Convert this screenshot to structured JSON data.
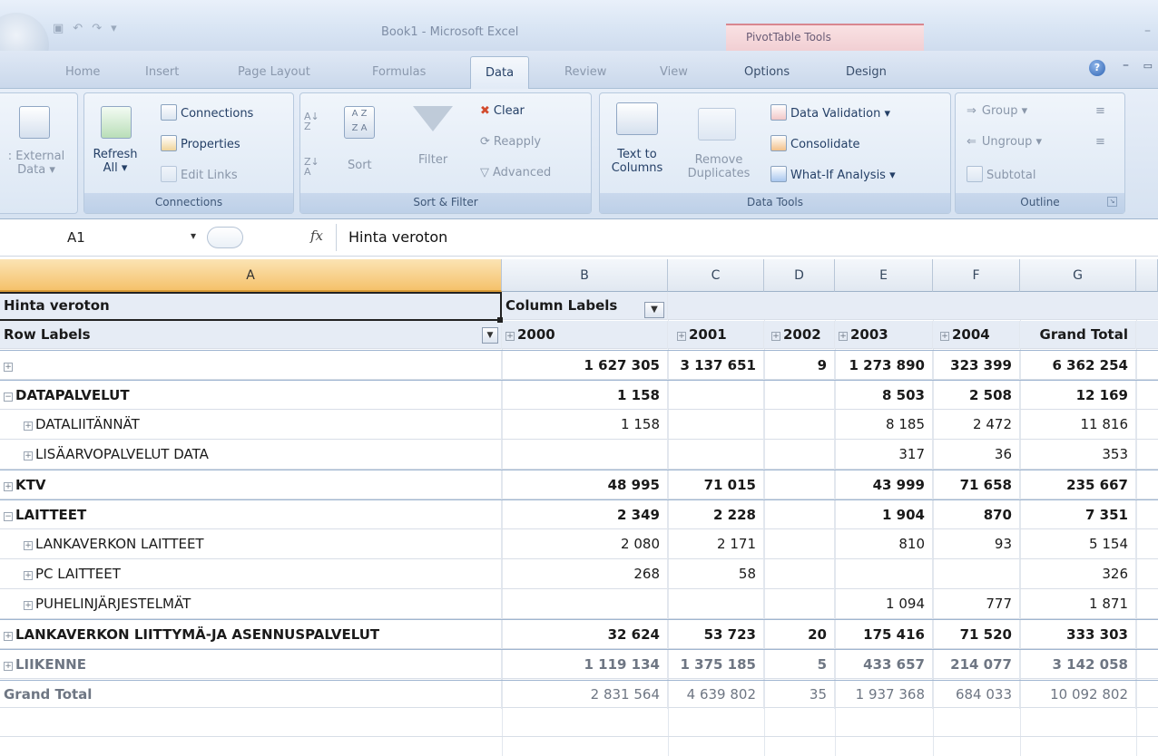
{
  "window": {
    "title": "Book1 - Microsoft Excel",
    "context_title": "PivotTable Tools"
  },
  "tabs": [
    "Home",
    "Insert",
    "Page Layout",
    "Formulas",
    "Data",
    "Review",
    "View",
    "Options",
    "Design"
  ],
  "active_tab": "Data",
  "ribbon": {
    "external": {
      "line1": ": External",
      "line2": "Data ▾"
    },
    "connections": {
      "refresh_line1": "Refresh",
      "refresh_line2": "All ▾",
      "connections": "Connections",
      "properties": "Properties",
      "edit_links": "Edit Links",
      "label": "Connections"
    },
    "sort_filter": {
      "sort": "Sort",
      "filter": "Filter",
      "clear": "Clear",
      "reapply": "Reapply",
      "advanced": "Advanced",
      "label": "Sort & Filter"
    },
    "data_tools": {
      "text_to_line1": "Text to",
      "text_to_line2": "Columns",
      "remove_line1": "Remove",
      "remove_line2": "Duplicates",
      "validation": "Data Validation ▾",
      "consolidate": "Consolidate",
      "whatif": "What-If Analysis ▾",
      "label": "Data Tools"
    },
    "outline": {
      "group": "Group ▾",
      "ungroup": "Ungroup ▾",
      "subtotal": "Subtotal",
      "label": "Outline"
    }
  },
  "formula_bar": {
    "name_box": "A1",
    "fx": "fx",
    "value": "Hinta veroton"
  },
  "columns": [
    "A",
    "B",
    "C",
    "D",
    "E",
    "F",
    "G"
  ],
  "pivot": {
    "value_field": "Hinta veroton",
    "column_labels": "Column Labels",
    "row_labels": "Row Labels",
    "years": [
      "2000",
      "2001",
      "2002",
      "2003",
      "2004"
    ],
    "grand_total_label": "Grand Total",
    "rows": [
      {
        "label": "",
        "level": 0,
        "bold": true,
        "exp": "⊞",
        "values": [
          "1 627 305",
          "3 137 651",
          "9",
          "1 273 890",
          "323 399",
          "6 362 254"
        ]
      },
      {
        "label": "DATAPALVELUT",
        "level": 0,
        "bold": true,
        "exp": "⊟",
        "values": [
          "1 158",
          "",
          "",
          "8 503",
          "2 508",
          "12 169"
        ]
      },
      {
        "label": "DATALIITÄNNÄT",
        "level": 1,
        "bold": false,
        "exp": "⊞",
        "values": [
          "1 158",
          "",
          "",
          "8 185",
          "2 472",
          "11 816"
        ]
      },
      {
        "label": "LISÄARVOPALVELUT DATA",
        "level": 1,
        "bold": false,
        "exp": "⊞",
        "values": [
          "",
          "",
          "",
          "317",
          "36",
          "353"
        ]
      },
      {
        "label": "KTV",
        "level": 0,
        "bold": true,
        "exp": "⊞",
        "values": [
          "48 995",
          "71 015",
          "",
          "43 999",
          "71 658",
          "235 667"
        ]
      },
      {
        "label": "LAITTEET",
        "level": 0,
        "bold": true,
        "exp": "⊟",
        "values": [
          "2 349",
          "2 228",
          "",
          "1 904",
          "870",
          "7 351"
        ]
      },
      {
        "label": "LANKAVERKON LAITTEET",
        "level": 1,
        "bold": false,
        "exp": "⊞",
        "values": [
          "2 080",
          "2 171",
          "",
          "810",
          "93",
          "5 154"
        ]
      },
      {
        "label": "PC LAITTEET",
        "level": 1,
        "bold": false,
        "exp": "⊞",
        "values": [
          "268",
          "58",
          "",
          "",
          "",
          "326"
        ]
      },
      {
        "label": "PUHELINJÄRJESTELMÄT",
        "level": 1,
        "bold": false,
        "exp": "⊞",
        "values": [
          "",
          "",
          "",
          "1 094",
          "777",
          "1 871"
        ]
      },
      {
        "label": "LANKAVERKON LIITTYMÄ-JA ASENNUSPALVELUT",
        "level": 0,
        "bold": true,
        "exp": "⊞",
        "values": [
          "32 624",
          "53 723",
          "20",
          "175 416",
          "71 520",
          "333 303"
        ]
      },
      {
        "label": "LIIKENNE",
        "level": 0,
        "bold": true,
        "exp": "⊞",
        "values": [
          "1 119 134",
          "1 375 185",
          "5",
          "433 657",
          "214 077",
          "3 142 058"
        ]
      }
    ],
    "grand_total": [
      "2 831 564",
      "4 639 802",
      "35",
      "1 937 368",
      "684 033",
      "10 092 802"
    ]
  }
}
